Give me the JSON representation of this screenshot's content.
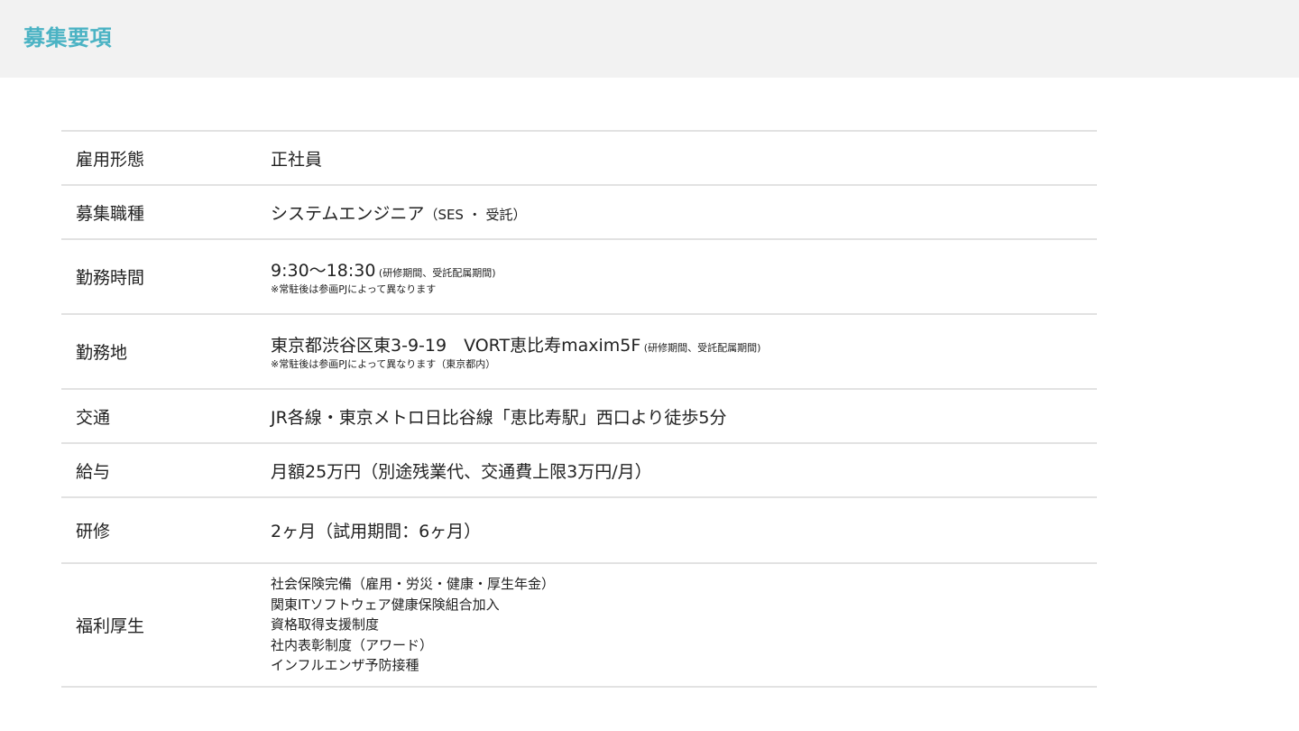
{
  "header": {
    "title": "募集要項"
  },
  "rows": {
    "employment": {
      "label": "雇用形態",
      "value": "正社員"
    },
    "position": {
      "label": "募集職種",
      "value": "システムエンジニア",
      "sub": "（SES ・ 受託）"
    },
    "hours": {
      "label": "勤務時間",
      "value": "9:30〜18:30",
      "small": " (研修期間、受託配属期間)",
      "note": "※常駐後は参画PJによって異なります"
    },
    "location": {
      "label": "勤務地",
      "value": "東京都渋谷区東3-9-19　VORT恵比寿maxim5F",
      "small": " (研修期間、受託配属期間)",
      "note": "※常駐後は参画PJによって異なります（東京都内）"
    },
    "access": {
      "label": "交通",
      "value": "JR各線・東京メトロ日比谷線「恵比寿駅」西口より徒歩5分"
    },
    "salary": {
      "label": "給与",
      "value": "月額25万円（別途残業代、交通費上限3万円/月）"
    },
    "training": {
      "label": "研修",
      "value": "2ヶ月（試用期間：6ヶ月）"
    },
    "benefits": {
      "label": "福利厚生",
      "items": [
        "社会保険完備（雇用・労災・健康・厚生年金）",
        "関東ITソフトウェア健康保険組合加入",
        "資格取得支援制度",
        "社内表彰制度（アワード）",
        "インフルエンザ予防接種"
      ]
    }
  }
}
